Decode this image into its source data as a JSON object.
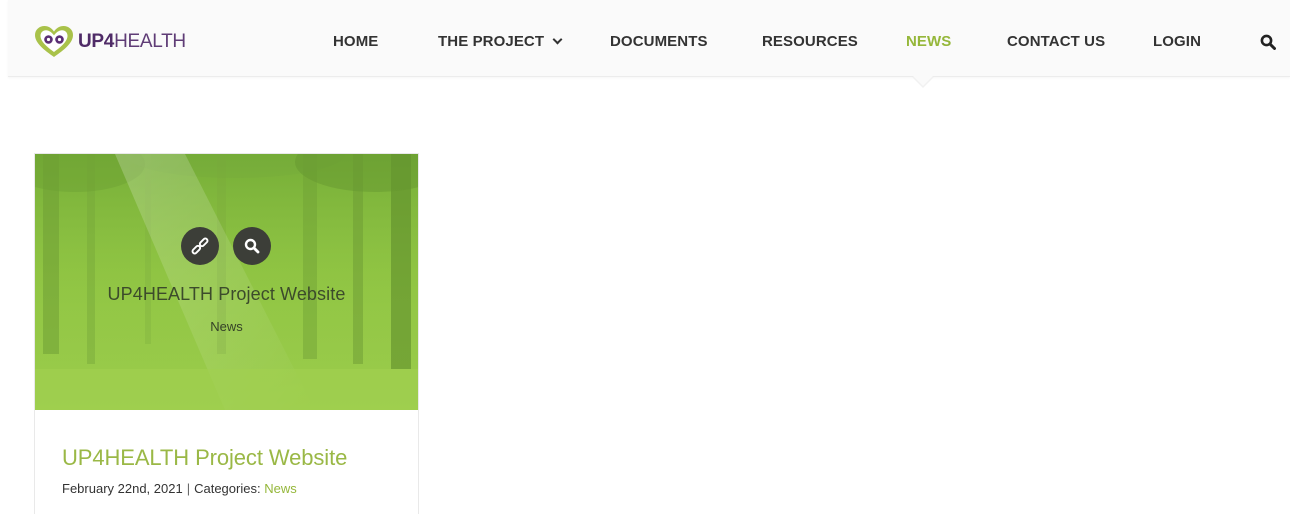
{
  "brand": {
    "logo_text_bold": "UP4",
    "logo_text_light": "HEALTH",
    "logo_color": "#4f2b67",
    "accent_color": "#95b73a"
  },
  "nav": {
    "home": "HOME",
    "project": "THE PROJECT",
    "documents": "DOCUMENTS",
    "resources": "RESOURCES",
    "news": "NEWS",
    "contact": "CONTACT US",
    "login": "LOGIN",
    "active_item": "NEWS",
    "project_icon": "chevron-down-icon",
    "search_icon": "search-icon"
  },
  "post": {
    "overlay_title": "UP4HEALTH Project Website",
    "overlay_category": "News",
    "link_icon": "link-icon",
    "zoom_icon": "search-icon",
    "title": "UP4HEALTH Project Website",
    "date": "February 22nd, 2021",
    "separator": "|",
    "categories_label": "Categories:",
    "category": "News"
  }
}
